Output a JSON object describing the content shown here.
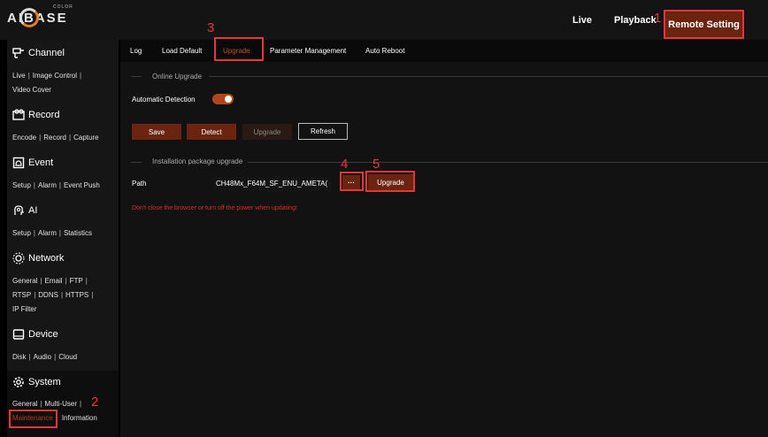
{
  "header": {
    "logo_text": "AIBASE",
    "logo_sub": "COLOR",
    "nav": {
      "live": "Live",
      "playback": "Playback",
      "remote_setting": "Remote Setting"
    }
  },
  "markers": [
    "1",
    "2",
    "3",
    "4",
    "5"
  ],
  "sidebar": {
    "channel": {
      "title": "Channel",
      "links": [
        "Live",
        "Image Control",
        "Video Cover"
      ]
    },
    "record": {
      "title": "Record",
      "links": [
        "Encode",
        "Record",
        "Capture"
      ]
    },
    "event": {
      "title": "Event",
      "links": [
        "Setup",
        "Alarm",
        "Event Push"
      ]
    },
    "ai": {
      "title": "AI",
      "links": [
        "Setup",
        "Alarm",
        "Statistics"
      ]
    },
    "network": {
      "title": "Network",
      "links": [
        "General",
        "Email",
        "FTP",
        "RTSP",
        "DDNS",
        "HTTPS",
        "IP Filter"
      ]
    },
    "device": {
      "title": "Device",
      "links": [
        "Disk",
        "Audio",
        "Cloud"
      ]
    },
    "system": {
      "title": "System",
      "links": [
        "General",
        "Multi-User",
        "Maintenance",
        "Information"
      ]
    },
    "separator": "|"
  },
  "tabs": [
    "Log",
    "Load Default",
    "Upgrade",
    "Parameter Management",
    "Auto Reboot"
  ],
  "online_upgrade": {
    "section_label": "Online Upgrade",
    "auto_detect_label": "Automatic Detection",
    "buttons": {
      "save": "Save",
      "detect": "Detect",
      "upgrade": "Upgrade",
      "refresh": "Refresh"
    }
  },
  "package_upgrade": {
    "section_label": "Installation package upgrade",
    "path_label": "Path",
    "path_value": "CH48Mx_F64M_SF_ENU_AMETA(",
    "browse_button": "···",
    "upgrade_button": "Upgrade",
    "warning": "Don't close the browser or turn off the power when updating!"
  },
  "colors": {
    "accent": "#6a2410",
    "highlight": "#e5373a",
    "warning": "#d62f2f"
  }
}
